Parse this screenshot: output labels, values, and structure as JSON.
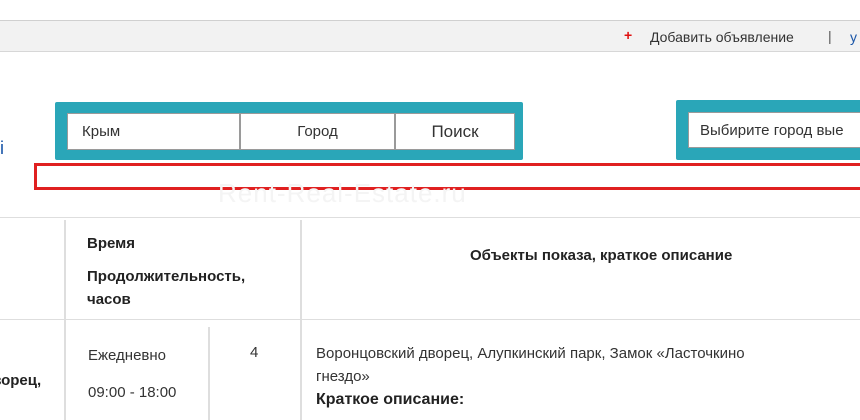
{
  "topbar": {
    "plus": "+",
    "add_listing": "Добавить объявление",
    "separator": "|",
    "user_link_fragment": "у"
  },
  "left_edge_fragment": "i",
  "search": {
    "region_value": "Крым",
    "city_value": "Город",
    "button_label": "Поиск"
  },
  "city_select": {
    "value": "Выбирите город вые"
  },
  "banner": {
    "watermark": "Rent-Real-Estate.ru"
  },
  "table": {
    "header": {
      "time_label": "Время",
      "duration_label": "Продолжительность,",
      "duration_unit": "часов",
      "objects_label": "Объекты показа, краткое описание"
    },
    "row": {
      "name_fragment_1": "зорец,",
      "schedule": "Ежедневно",
      "hours": "09:00 - 18:00",
      "duration": "4",
      "objects_line1": "Воронцовский дворец, Алупкинский парк, Замок «Ласточкино",
      "objects_line2": "гнездо»",
      "short_desc_label": "Краткое описание",
      "short_desc_colon": ":"
    }
  },
  "colors": {
    "frame_teal": "#2aa6b8",
    "banner_red": "#e02020",
    "link_blue": "#1a56a8",
    "plus_red": "#e01010"
  }
}
